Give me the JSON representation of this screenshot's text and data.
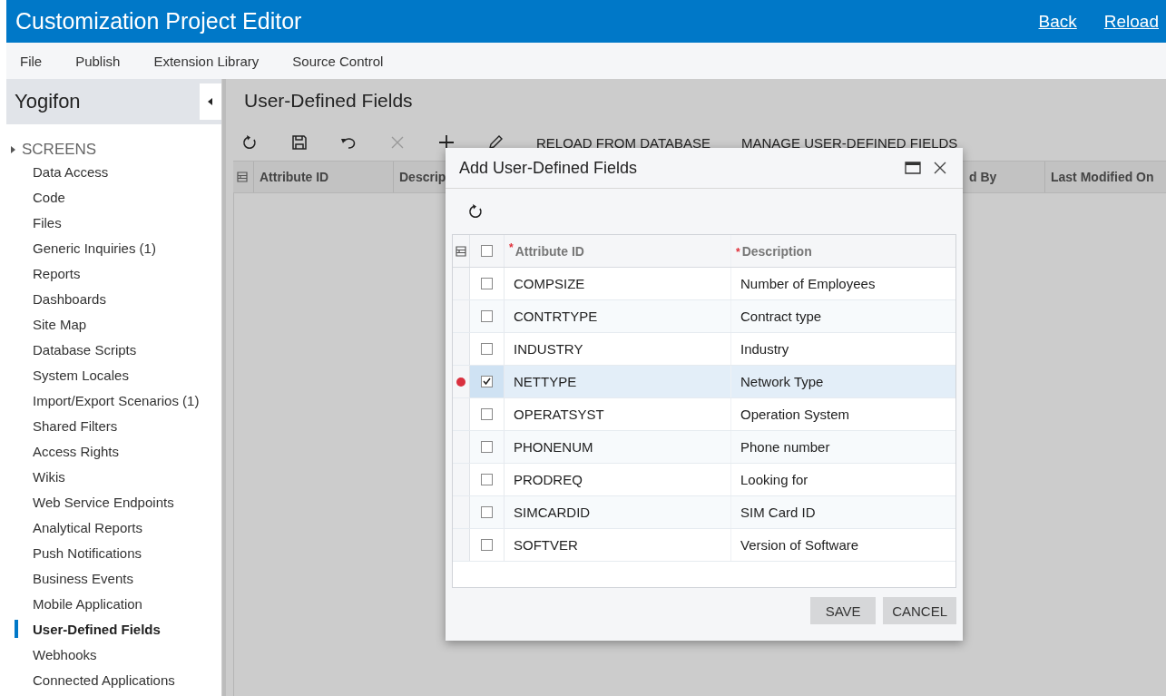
{
  "window": {
    "title": "Customization Project Editor",
    "links": [
      "Back",
      "Reload"
    ]
  },
  "menu": [
    "File",
    "Publish",
    "Extension Library",
    "Source Control"
  ],
  "sidebar": {
    "project": "Yogifon",
    "group": "SCREENS",
    "items": [
      {
        "label": "Data Access",
        "selected": false
      },
      {
        "label": "Code",
        "selected": false
      },
      {
        "label": "Files",
        "selected": false
      },
      {
        "label": "Generic Inquiries (1)",
        "selected": false
      },
      {
        "label": "Reports",
        "selected": false
      },
      {
        "label": "Dashboards",
        "selected": false
      },
      {
        "label": "Site Map",
        "selected": false
      },
      {
        "label": "Database Scripts",
        "selected": false
      },
      {
        "label": "System Locales",
        "selected": false
      },
      {
        "label": "Import/Export Scenarios (1)",
        "selected": false
      },
      {
        "label": "Shared Filters",
        "selected": false
      },
      {
        "label": "Access Rights",
        "selected": false
      },
      {
        "label": "Wikis",
        "selected": false
      },
      {
        "label": "Web Service Endpoints",
        "selected": false
      },
      {
        "label": "Analytical Reports",
        "selected": false
      },
      {
        "label": "Push Notifications",
        "selected": false
      },
      {
        "label": "Business Events",
        "selected": false
      },
      {
        "label": "Mobile Application",
        "selected": false
      },
      {
        "label": "User-Defined Fields",
        "selected": true
      },
      {
        "label": "Webhooks",
        "selected": false
      },
      {
        "label": "Connected Applications",
        "selected": false
      }
    ]
  },
  "page": {
    "title": "User-Defined Fields",
    "toolbar_buttons": [
      "RELOAD FROM DATABASE",
      "MANAGE USER-DEFINED FIELDS"
    ],
    "columns": [
      "Attribute ID",
      "Descrip",
      "d By",
      "Last Modified On"
    ]
  },
  "dialog": {
    "title": "Add User-Defined Fields",
    "columns": [
      {
        "label": "Attribute ID",
        "required_mark": "*"
      },
      {
        "label": "Description",
        "required_mark": "*"
      }
    ],
    "all_checked": false,
    "rows": [
      {
        "id": "COMPSIZE",
        "description": "Number of Employees",
        "checked": false,
        "selected": false,
        "modified": false
      },
      {
        "id": "CONTRTYPE",
        "description": "Contract type",
        "checked": false,
        "selected": false,
        "modified": false
      },
      {
        "id": "INDUSTRY",
        "description": "Industry",
        "checked": false,
        "selected": false,
        "modified": false
      },
      {
        "id": "NETTYPE",
        "description": "Network Type",
        "checked": true,
        "selected": true,
        "modified": true
      },
      {
        "id": "OPERATSYST",
        "description": "Operation System",
        "checked": false,
        "selected": false,
        "modified": false
      },
      {
        "id": "PHONENUM",
        "description": "Phone number",
        "checked": false,
        "selected": false,
        "modified": false
      },
      {
        "id": "PRODREQ",
        "description": "Looking for",
        "checked": false,
        "selected": false,
        "modified": false
      },
      {
        "id": "SIMCARDID",
        "description": "SIM Card ID",
        "checked": false,
        "selected": false,
        "modified": false
      },
      {
        "id": "SOFTVER",
        "description": "Version of Software",
        "checked": false,
        "selected": false,
        "modified": false
      }
    ],
    "buttons": [
      "SAVE",
      "CANCEL"
    ]
  }
}
